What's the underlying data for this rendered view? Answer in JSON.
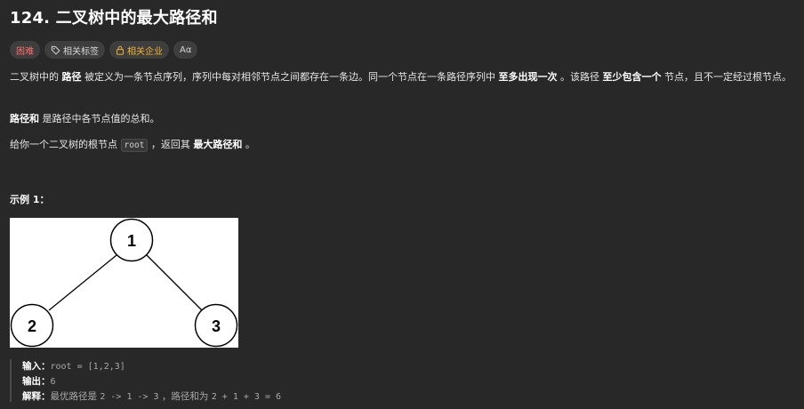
{
  "problem": {
    "title": "124. 二叉树中的最大路径和"
  },
  "tags": {
    "difficulty": "困难",
    "related_tags": "相关标签",
    "related_companies": "相关企业",
    "font_toggle": "Aα"
  },
  "description": {
    "p1_a": "二叉树中的 ",
    "p1_b": "路径",
    "p1_c": " 被定义为一条节点序列，序列中每对相邻节点之间都存在一条边。同一个节点在一条路径序列中 ",
    "p1_d": "至多出现一次",
    "p1_e": " 。该路径 ",
    "p1_f": "至少包含一个",
    "p1_g": " 节点，且不一定经过根节点。",
    "p2_a": "路径和",
    "p2_b": " 是路径中各节点值的总和。",
    "p3_a": "给你一个二叉树的根节点 ",
    "p3_code": "root",
    "p3_b": " ，返回其 ",
    "p3_c": "最大路径和",
    "p3_d": " 。"
  },
  "example": {
    "title": "示例 1：",
    "tree_nodes": [
      "1",
      "2",
      "3"
    ],
    "input_label": "输入：",
    "input_value": "root = [1,2,3]",
    "output_label": "输出：",
    "output_value": "6",
    "explain_label": "解释：",
    "explain_a": "最优路径是 ",
    "explain_code1": "2 -> 1 -> 3",
    "explain_b": " ，路径和为 ",
    "explain_code2": "2 + 1 + 3 = 6"
  },
  "colors": {
    "background": "#282828",
    "difficulty_red": "#ff6b6b",
    "company_gold": "#f0b232"
  }
}
